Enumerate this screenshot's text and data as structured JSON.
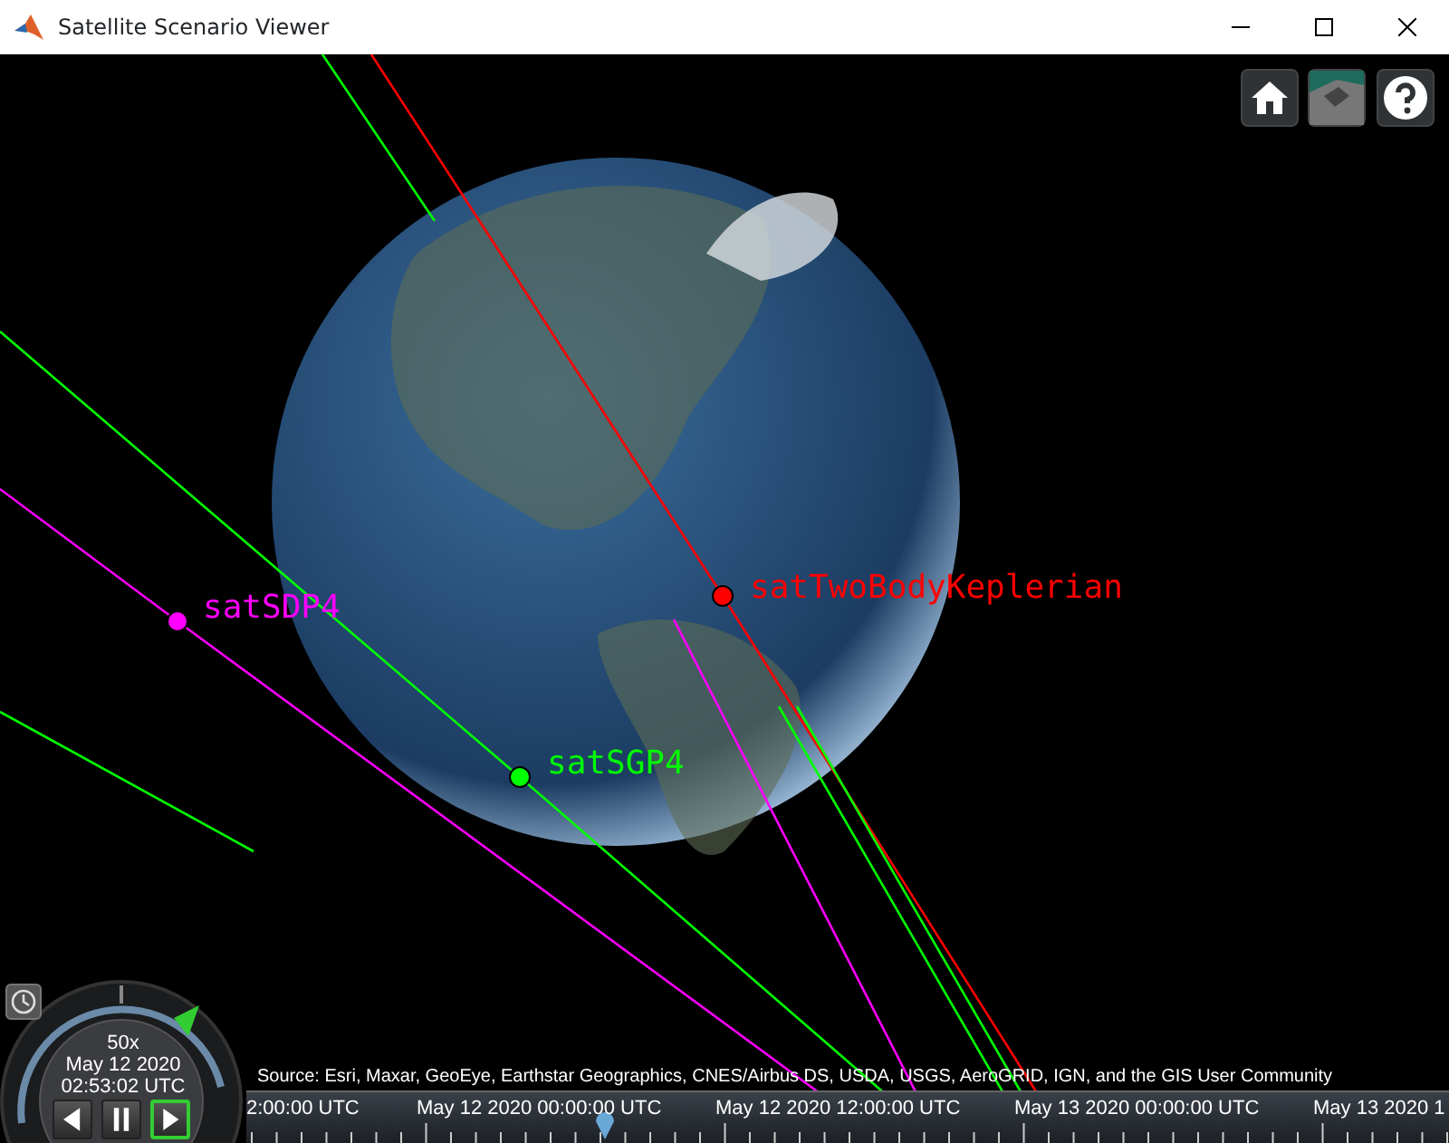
{
  "window": {
    "title": "Satellite Scenario Viewer"
  },
  "satellites": [
    {
      "name": "satSDP4",
      "color": "#ff00ff"
    },
    {
      "name": "satTwoBodyKeplerian",
      "color": "#ff0000"
    },
    {
      "name": "satSGP4",
      "color": "#00ff00"
    }
  ],
  "attribution": "Source: Esri, Maxar, GeoEye, Earthstar Geographics, CNES/Airbus DS, USDA, USGS, AeroGRID, IGN, and the GIS User Community",
  "clock": {
    "speed": "50x",
    "date": "May 12 2020",
    "time": "02:53:02 UTC",
    "controls": [
      {
        "kind": "back",
        "selected": false
      },
      {
        "kind": "pause",
        "selected": false
      },
      {
        "kind": "play",
        "selected": true
      }
    ]
  },
  "timeline": {
    "labels": [
      "2:00:00 UTC",
      "May 12 2020 00:00:00 UTC",
      "May 12 2020 12:00:00 UTC",
      "May 13 2020 00:00:00 UTC",
      "May 13 2020 1"
    ]
  }
}
